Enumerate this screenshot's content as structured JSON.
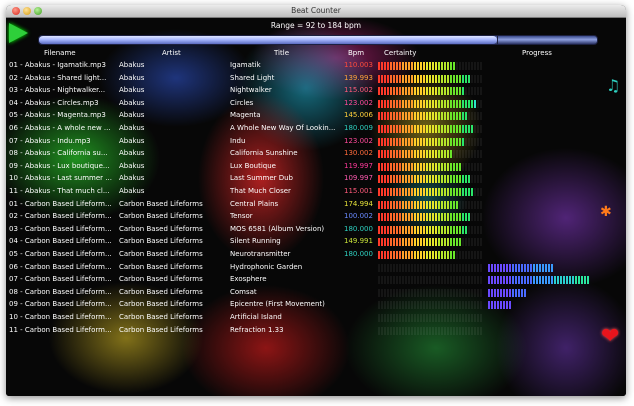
{
  "window": {
    "title": "Beat Counter"
  },
  "range_text": "Range = 92 to 184 bpm",
  "progress": {
    "value": 0.82,
    "divider": 0.82
  },
  "columns": [
    "Filename",
    "Artist",
    "Title",
    "Bpm",
    "Certainty",
    "Progress"
  ],
  "rows": [
    {
      "filename": "01 - Abakus - Igamatik.mp3",
      "artist": "Abakus",
      "title": "Igamatik",
      "bpm": "110.003",
      "bpm_color": "#ff4a3a",
      "certainty": 26,
      "progress": null
    },
    {
      "filename": "02 - Abakus - Shared light...",
      "artist": "Abakus",
      "title": "Shared Light",
      "bpm": "139.993",
      "bpm_color": "#ffa23a",
      "certainty": 31,
      "progress": null
    },
    {
      "filename": "03 - Abakus - Nightwalker...",
      "artist": "Abakus",
      "title": "Nightwalker",
      "bpm": "115.002",
      "bpm_color": "#ff5a7a",
      "certainty": 29,
      "progress": null
    },
    {
      "filename": "04 - Abakus - Circles.mp3",
      "artist": "Abakus",
      "title": "Circles",
      "bpm": "123.002",
      "bpm_color": "#ff4a9a",
      "certainty": 33,
      "progress": null
    },
    {
      "filename": "05 - Abakus - Magenta.mp3",
      "artist": "Abakus",
      "title": "Magenta",
      "bpm": "145.006",
      "bpm_color": "#ffcf3a",
      "certainty": 30,
      "progress": null
    },
    {
      "filename": "06 - Abakus - A whole new ...",
      "artist": "Abakus",
      "title": "A Whole New Way Of Lookin...",
      "bpm": "180.009",
      "bpm_color": "#2ed0c0",
      "certainty": 32,
      "progress": null
    },
    {
      "filename": "07 - Abakus - Indu.mp3",
      "artist": "Abakus",
      "title": "Indu",
      "bpm": "123.002",
      "bpm_color": "#ff4a9a",
      "certainty": 29,
      "progress": null
    },
    {
      "filename": "08 - Abakus - California su...",
      "artist": "Abakus",
      "title": "California Sunshine",
      "bpm": "130.002",
      "bpm_color": "#ff6a3a",
      "certainty": 25,
      "progress": null
    },
    {
      "filename": "09 - Abakus - Lux boutique...",
      "artist": "Abakus",
      "title": "Lux Boutique",
      "bpm": "119.997",
      "bpm_color": "#ff3a9a",
      "certainty": 28,
      "progress": null
    },
    {
      "filename": "10 - Abakus - Last summer ...",
      "artist": "Abakus",
      "title": "Last Summer Dub",
      "bpm": "109.997",
      "bpm_color": "#ff5ab0",
      "certainty": 31,
      "progress": null
    },
    {
      "filename": "11 - Abakus - That much cl...",
      "artist": "Abakus",
      "title": "That Much Closer",
      "bpm": "115.001",
      "bpm_color": "#ff5a7a",
      "certainty": 32,
      "progress": null
    },
    {
      "filename": "01 - Carbon Based Lifeform...",
      "artist": "Carbon Based Lifeforms",
      "title": "Central Plains",
      "bpm": "174.994",
      "bpm_color": "#e6e23a",
      "certainty": 27,
      "progress": null
    },
    {
      "filename": "02 - Carbon Based Lifeform...",
      "artist": "Carbon Based Lifeforms",
      "title": "Tensor",
      "bpm": "100.002",
      "bpm_color": "#6a8aff",
      "certainty": 31,
      "progress": null
    },
    {
      "filename": "03 - Carbon Based Lifeform...",
      "artist": "Carbon Based Lifeforms",
      "title": "MOS 6581 (Album Version)",
      "bpm": "180.000",
      "bpm_color": "#2ed0c0",
      "certainty": 30,
      "progress": null
    },
    {
      "filename": "04 - Carbon Based Lifeform...",
      "artist": "Carbon Based Lifeforms",
      "title": "Silent Running",
      "bpm": "149.991",
      "bpm_color": "#c8e23a",
      "certainty": 28,
      "progress": null
    },
    {
      "filename": "05 - Carbon Based Lifeform...",
      "artist": "Carbon Based Lifeforms",
      "title": "Neurotransmitter",
      "bpm": "180.000",
      "bpm_color": "#2ed0c0",
      "certainty": 26,
      "progress": null
    },
    {
      "filename": "06 - Carbon Based Lifeform...",
      "artist": "Carbon Based Lifeforms",
      "title": "Hydrophonic Garden",
      "bpm": "",
      "bpm_color": "#ffffff",
      "certainty": 0,
      "progress": 0.62
    },
    {
      "filename": "07 - Carbon Based Lifeform...",
      "artist": "Carbon Based Lifeforms",
      "title": "Exosphere",
      "bpm": "",
      "bpm_color": "#ffffff",
      "certainty": 0,
      "progress": 0.95
    },
    {
      "filename": "08 - Carbon Based Lifeform...",
      "artist": "Carbon Based Lifeforms",
      "title": "Comsat",
      "bpm": "",
      "bpm_color": "#ffffff",
      "certainty": 0,
      "progress": 0.35
    },
    {
      "filename": "09 - Carbon Based Lifeform...",
      "artist": "Carbon Based Lifeforms",
      "title": "Epicentre (First Movement)",
      "bpm": "",
      "bpm_color": "#ffffff",
      "certainty": 0,
      "progress": 0.22
    },
    {
      "filename": "10 - Carbon Based Lifeform...",
      "artist": "Carbon Based Lifeforms",
      "title": "Artificial Island",
      "bpm": "",
      "bpm_color": "#ffffff",
      "certainty": 0,
      "progress": 0
    },
    {
      "filename": "11 - Carbon Based Lifeform...",
      "artist": "Carbon Based Lifeforms",
      "title": "Refraction 1.33",
      "bpm": "",
      "bpm_color": "#ffffff",
      "certainty": 0,
      "progress": 0
    }
  ],
  "icons": {
    "play": "play-icon",
    "note": "music-note-icon",
    "gear": "gear-icon",
    "heart": "heart-icon"
  }
}
